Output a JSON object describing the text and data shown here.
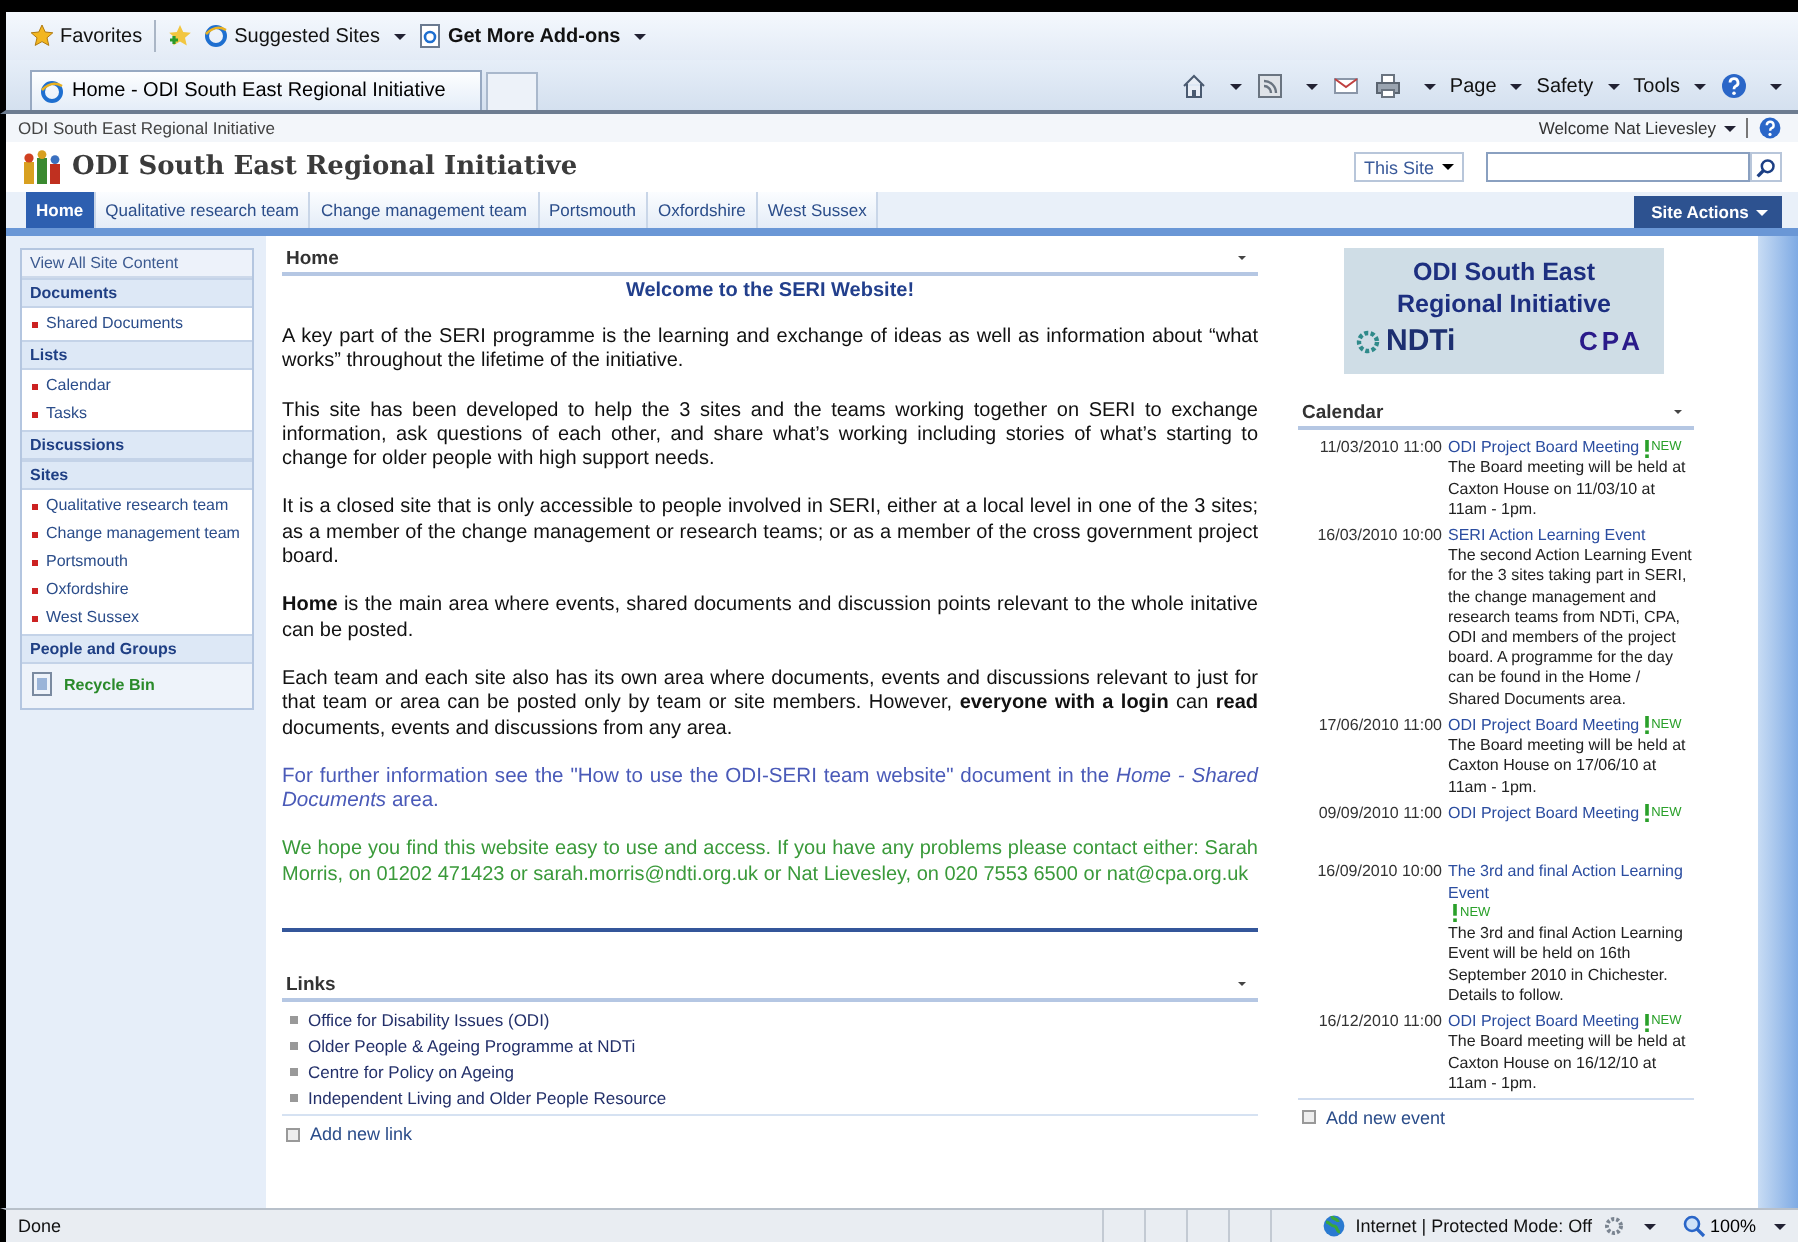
{
  "browser": {
    "favorites": "Favorites",
    "suggested_sites": "Suggested Sites",
    "add_ons": "Get More Add-ons",
    "tab_title": "Home - ODI South East Regional Initiative",
    "menus": [
      "Page",
      "Safety",
      "Tools"
    ]
  },
  "site": {
    "breadcrumb": "ODI South East Regional Initiative",
    "welcome": "Welcome Nat Lievesley",
    "title": "ODI South East Regional Initiative",
    "search_scope": "This Site",
    "nav_tabs": [
      {
        "label": "Home",
        "selected": true
      },
      {
        "label": "Qualitative research team",
        "selected": false
      },
      {
        "label": "Change management team",
        "selected": false
      },
      {
        "label": "Portsmouth",
        "selected": false
      },
      {
        "label": "Oxfordshire",
        "selected": false
      },
      {
        "label": "West Sussex",
        "selected": false
      }
    ],
    "site_actions": "Site Actions"
  },
  "sidebar": {
    "view_all": "View All Site Content",
    "sections": [
      {
        "heading": "Documents",
        "items": [
          "Shared Documents"
        ]
      },
      {
        "heading": "Lists",
        "items": [
          "Calendar",
          "Tasks"
        ]
      },
      {
        "heading": "Discussions"
      },
      {
        "heading": "Sites",
        "items": [
          "Qualitative research team",
          "Change management team",
          "Portsmouth",
          "Oxfordshire",
          "West Sussex"
        ]
      },
      {
        "heading": "People and Groups"
      }
    ],
    "recycle_bin": "Recycle Bin"
  },
  "home": {
    "title": "Home",
    "heading": "Welcome to the SERI Website!",
    "paragraphs": [
      {
        "kind": "plain",
        "text": "A key part of the SERI programme is the learning and exchange of ideas as well as information about “what works” throughout the lifetime of the initiative."
      },
      {
        "kind": "plain",
        "text": "This site has been developed to help the 3 sites and the teams working together on SERI to exchange information, ask questions of each other, and share what’s working including stories of what’s starting to change for older people with high support needs."
      },
      {
        "kind": "plain",
        "text": "It is a closed site that is only accessible to people involved in SERI, either at a local level in one of the 3 sites; as a member of the change management or research teams; or as a member of the cross government project board."
      },
      {
        "kind": "plain",
        "text": "**Home** is the main area where events, shared documents and discussion points relevant to the whole initative can be posted."
      },
      {
        "kind": "plain",
        "text": "Each team and each site also has its own area where documents, events and discussions relevant to just for that team or area can be posted only by team or site members. However, **everyone with a login** can **read** documents, events and discussions from any area."
      },
      {
        "kind": "info",
        "text": "For further information see the \"How to use the ODI-SERI team website\" document in the *Home - Shared Documents* area."
      },
      {
        "kind": "contact",
        "text": "We hope you find this website easy to use and access. If you have any problems please contact either: Sarah Morris, on 01202 471423 or sarah.morris@ndti.org.uk or Nat Lievesley, on 020 7553 6500 or nat@cpa.org.uk"
      }
    ]
  },
  "links": {
    "title": "Links",
    "items": [
      "Office for Disability Issues (ODI)",
      "Older People & Ageing Programme at NDTi",
      "Centre for Policy on Ageing",
      "Independent Living and Older People Resource"
    ],
    "add": "Add new link"
  },
  "logo": {
    "title_lines": [
      "ODI South East",
      "Regional Initiative"
    ],
    "ndti": "NDTi",
    "cpa": "CPA"
  },
  "calendar": {
    "title": "Calendar",
    "events": [
      {
        "date": "11/03/2010 11:00",
        "title": "ODI Project Board Meeting",
        "badge": "NEW",
        "description": "The Board meeting will be held at Caxton House on 11/03/10 at 11am - 1pm."
      },
      {
        "date": "16/03/2010 10:00",
        "title": "SERI Action Learning Event",
        "description": "The second Action Learning Event for the 3 sites taking part in SERI, the change management and research teams from NDTi, CPA, ODI and members of the project board. A programme for the day can be found in the Home / Shared Documents area."
      },
      {
        "date": "17/06/2010 11:00",
        "title": "ODI Project Board Meeting",
        "badge": "NEW",
        "description": "The Board meeting will be held at Caxton House on 17/06/10 at 11am - 1pm."
      },
      {
        "date": "09/09/2010 11:00",
        "title": "ODI Project Board Meeting",
        "badge": "NEW"
      },
      {
        "date": "16/09/2010 10:00",
        "title": "The 3rd and final Action Learning Event",
        "badge": "NEW",
        "description": "The 3rd and final Action Learning Event will be held on 16th September 2010 in Chichester. Details to follow."
      },
      {
        "date": "16/12/2010 11:00",
        "title": "ODI Project Board Meeting",
        "badge": "NEW",
        "description": "The Board meeting will be held at Caxton House on 16/12/10 at 11am - 1pm."
      }
    ],
    "add": "Add new event"
  },
  "status_bar": {
    "text": "Done",
    "zone": "Internet | Protected Mode: Off",
    "zoom": "100%"
  }
}
